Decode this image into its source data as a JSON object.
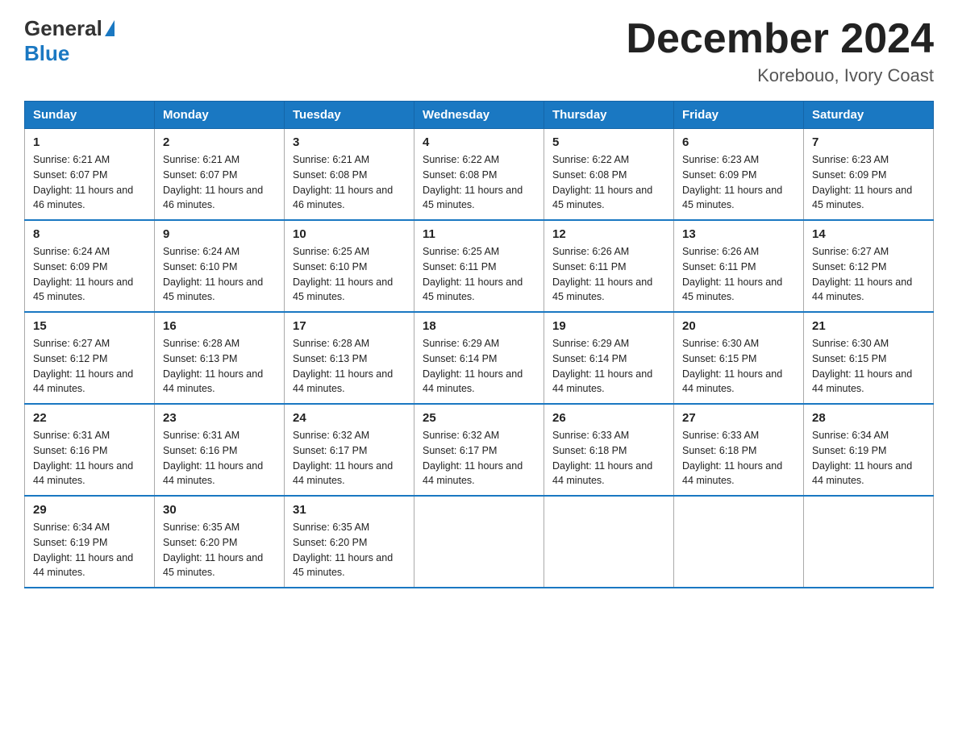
{
  "logo": {
    "general": "General",
    "blue": "Blue"
  },
  "title": "December 2024",
  "subtitle": "Korebouo, Ivory Coast",
  "days_of_week": [
    "Sunday",
    "Monday",
    "Tuesday",
    "Wednesday",
    "Thursday",
    "Friday",
    "Saturday"
  ],
  "weeks": [
    [
      {
        "day": "1",
        "sunrise": "6:21 AM",
        "sunset": "6:07 PM",
        "daylight": "11 hours and 46 minutes."
      },
      {
        "day": "2",
        "sunrise": "6:21 AM",
        "sunset": "6:07 PM",
        "daylight": "11 hours and 46 minutes."
      },
      {
        "day": "3",
        "sunrise": "6:21 AM",
        "sunset": "6:08 PM",
        "daylight": "11 hours and 46 minutes."
      },
      {
        "day": "4",
        "sunrise": "6:22 AM",
        "sunset": "6:08 PM",
        "daylight": "11 hours and 45 minutes."
      },
      {
        "day": "5",
        "sunrise": "6:22 AM",
        "sunset": "6:08 PM",
        "daylight": "11 hours and 45 minutes."
      },
      {
        "day": "6",
        "sunrise": "6:23 AM",
        "sunset": "6:09 PM",
        "daylight": "11 hours and 45 minutes."
      },
      {
        "day": "7",
        "sunrise": "6:23 AM",
        "sunset": "6:09 PM",
        "daylight": "11 hours and 45 minutes."
      }
    ],
    [
      {
        "day": "8",
        "sunrise": "6:24 AM",
        "sunset": "6:09 PM",
        "daylight": "11 hours and 45 minutes."
      },
      {
        "day": "9",
        "sunrise": "6:24 AM",
        "sunset": "6:10 PM",
        "daylight": "11 hours and 45 minutes."
      },
      {
        "day": "10",
        "sunrise": "6:25 AM",
        "sunset": "6:10 PM",
        "daylight": "11 hours and 45 minutes."
      },
      {
        "day": "11",
        "sunrise": "6:25 AM",
        "sunset": "6:11 PM",
        "daylight": "11 hours and 45 minutes."
      },
      {
        "day": "12",
        "sunrise": "6:26 AM",
        "sunset": "6:11 PM",
        "daylight": "11 hours and 45 minutes."
      },
      {
        "day": "13",
        "sunrise": "6:26 AM",
        "sunset": "6:11 PM",
        "daylight": "11 hours and 45 minutes."
      },
      {
        "day": "14",
        "sunrise": "6:27 AM",
        "sunset": "6:12 PM",
        "daylight": "11 hours and 44 minutes."
      }
    ],
    [
      {
        "day": "15",
        "sunrise": "6:27 AM",
        "sunset": "6:12 PM",
        "daylight": "11 hours and 44 minutes."
      },
      {
        "day": "16",
        "sunrise": "6:28 AM",
        "sunset": "6:13 PM",
        "daylight": "11 hours and 44 minutes."
      },
      {
        "day": "17",
        "sunrise": "6:28 AM",
        "sunset": "6:13 PM",
        "daylight": "11 hours and 44 minutes."
      },
      {
        "day": "18",
        "sunrise": "6:29 AM",
        "sunset": "6:14 PM",
        "daylight": "11 hours and 44 minutes."
      },
      {
        "day": "19",
        "sunrise": "6:29 AM",
        "sunset": "6:14 PM",
        "daylight": "11 hours and 44 minutes."
      },
      {
        "day": "20",
        "sunrise": "6:30 AM",
        "sunset": "6:15 PM",
        "daylight": "11 hours and 44 minutes."
      },
      {
        "day": "21",
        "sunrise": "6:30 AM",
        "sunset": "6:15 PM",
        "daylight": "11 hours and 44 minutes."
      }
    ],
    [
      {
        "day": "22",
        "sunrise": "6:31 AM",
        "sunset": "6:16 PM",
        "daylight": "11 hours and 44 minutes."
      },
      {
        "day": "23",
        "sunrise": "6:31 AM",
        "sunset": "6:16 PM",
        "daylight": "11 hours and 44 minutes."
      },
      {
        "day": "24",
        "sunrise": "6:32 AM",
        "sunset": "6:17 PM",
        "daylight": "11 hours and 44 minutes."
      },
      {
        "day": "25",
        "sunrise": "6:32 AM",
        "sunset": "6:17 PM",
        "daylight": "11 hours and 44 minutes."
      },
      {
        "day": "26",
        "sunrise": "6:33 AM",
        "sunset": "6:18 PM",
        "daylight": "11 hours and 44 minutes."
      },
      {
        "day": "27",
        "sunrise": "6:33 AM",
        "sunset": "6:18 PM",
        "daylight": "11 hours and 44 minutes."
      },
      {
        "day": "28",
        "sunrise": "6:34 AM",
        "sunset": "6:19 PM",
        "daylight": "11 hours and 44 minutes."
      }
    ],
    [
      {
        "day": "29",
        "sunrise": "6:34 AM",
        "sunset": "6:19 PM",
        "daylight": "11 hours and 44 minutes."
      },
      {
        "day": "30",
        "sunrise": "6:35 AM",
        "sunset": "6:20 PM",
        "daylight": "11 hours and 45 minutes."
      },
      {
        "day": "31",
        "sunrise": "6:35 AM",
        "sunset": "6:20 PM",
        "daylight": "11 hours and 45 minutes."
      },
      null,
      null,
      null,
      null
    ]
  ]
}
